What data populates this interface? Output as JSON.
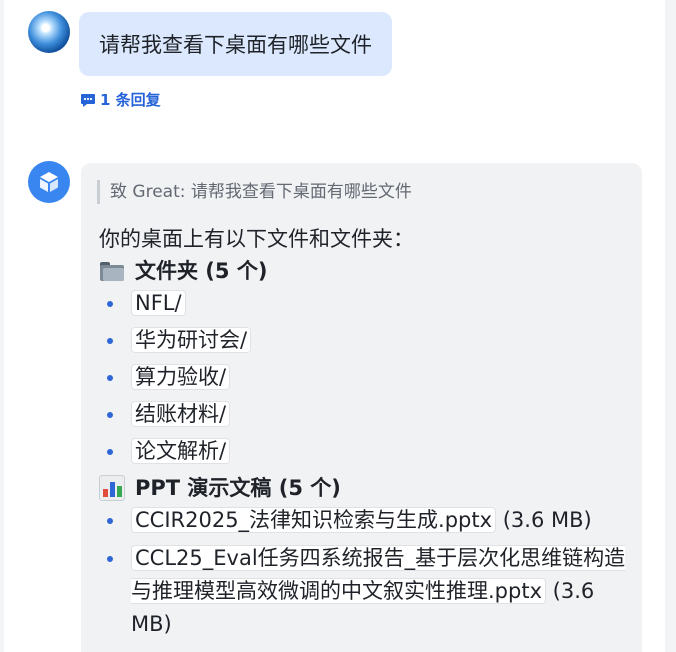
{
  "user_message": {
    "text": "请帮我查看下桌面有哪些文件",
    "reply_count": "1 条回复"
  },
  "bot_message": {
    "quote": "致 Great: 请帮我查看下桌面有哪些文件",
    "intro": "你的桌面上有以下文件和文件夹：",
    "folders_heading": "文件夹 (5 个)",
    "folders": [
      {
        "name": "NFL",
        "suffix": "/"
      },
      {
        "name": "华为研讨会",
        "suffix": "/"
      },
      {
        "name": "算力验收",
        "suffix": "/"
      },
      {
        "name": "结账材料",
        "suffix": "/"
      },
      {
        "name": "论文解析",
        "suffix": "/"
      }
    ],
    "ppt_heading": "PPT 演示文稿 (5 个)",
    "ppt_files": [
      {
        "name": "CCIR2025_法律知识检索与生成.pptx",
        "size": " (3.6 MB)"
      },
      {
        "name": "CCL25_Eval任务四系统报告_基于层次化思维链构造与推理模型高效微调的中文叙实性推理.pptx",
        "size": " (3.6 MB)"
      }
    ],
    "icons": {
      "folder": "folder-emoji-icon",
      "chart": "bar-chart-emoji-icon",
      "reply": "comment-icon",
      "bot_avatar": "cube-icon"
    }
  },
  "colors": {
    "user_bubble": "#dbe8fd",
    "bot_card": "#f1f2f4",
    "accent": "#2563d8",
    "bullet": "#2f66d6"
  }
}
